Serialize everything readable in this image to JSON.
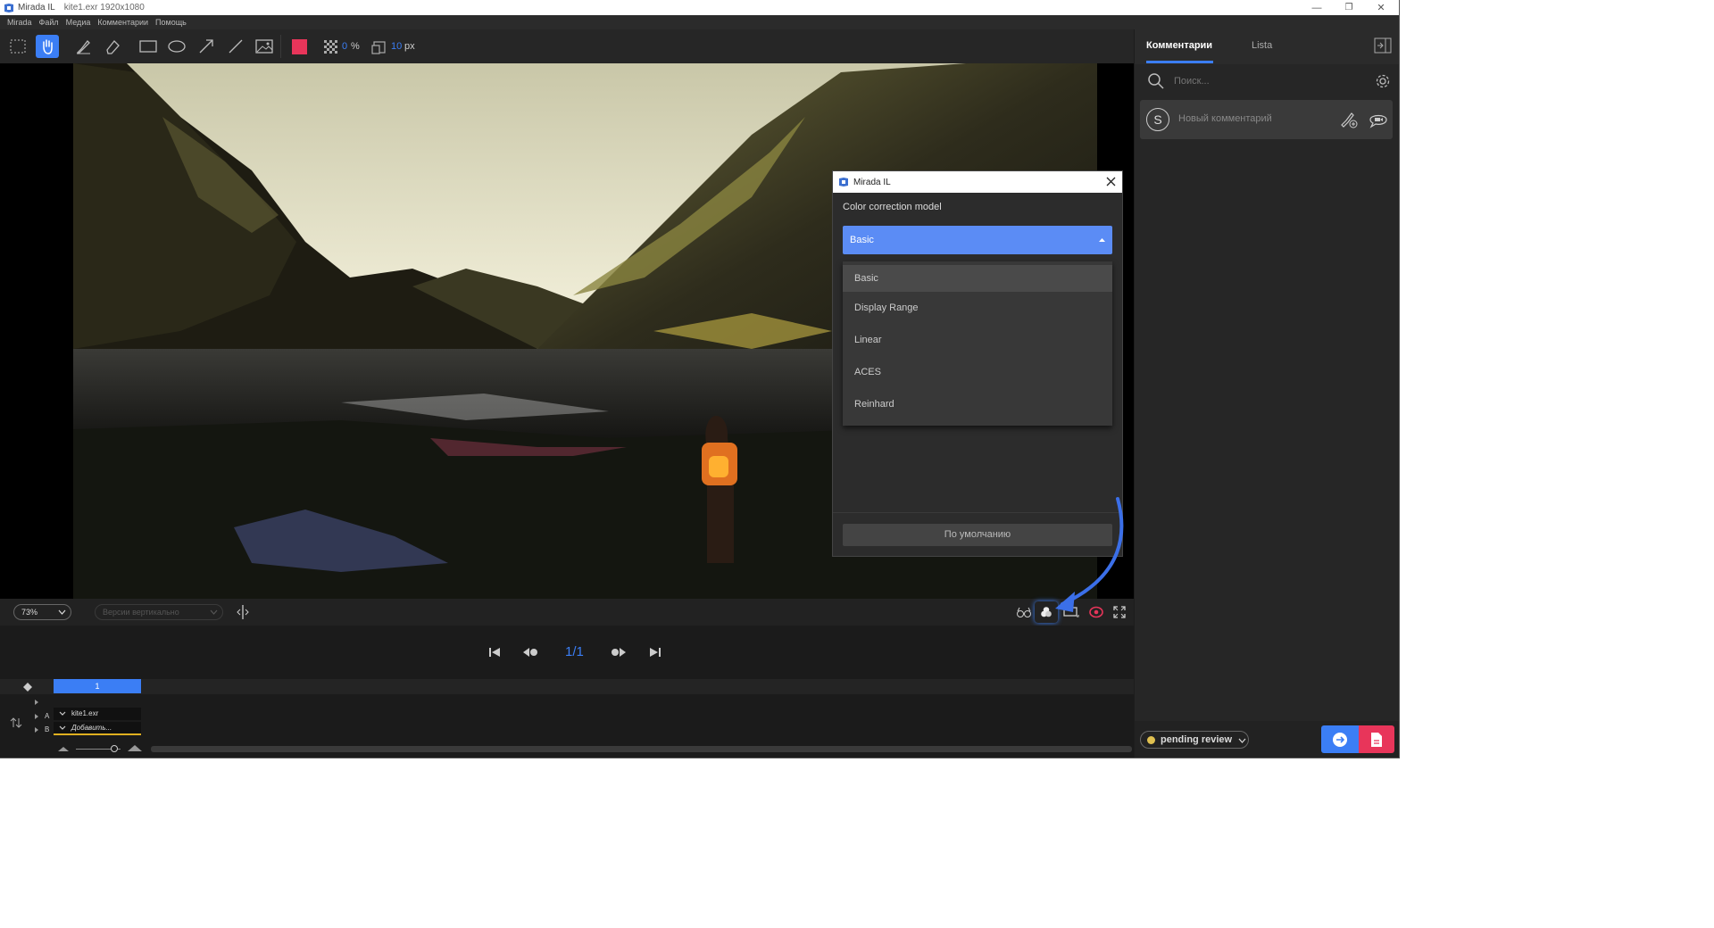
{
  "window": {
    "app_name": "Mirada IL",
    "file_title": "kite1.exr 1920x1080",
    "controls": {
      "minimize": "—",
      "restore": "❐",
      "close": "✕"
    }
  },
  "menu": [
    "Mirada",
    "Файл",
    "Медиа",
    "Комментарии",
    "Помощь"
  ],
  "toolbar": {
    "color": "#e8355a",
    "opacity_value": "0",
    "opacity_unit": "%",
    "stroke_value": "10",
    "stroke_unit": "px"
  },
  "viewer_bar": {
    "zoom": "73%",
    "version_mode": "Версии вертикально"
  },
  "player": {
    "frame_counter": "1/1"
  },
  "timeline": {
    "ruler_label": "1",
    "track_a_label": "A",
    "track_b_label": "B",
    "track_a_clip": "kite1.exr",
    "track_b_clip": "Добавить..."
  },
  "right_panel": {
    "tabs": [
      "Комментарии",
      "Lista"
    ],
    "active_tab": 0,
    "search_placeholder": "Поиск...",
    "avatar_letter": "S",
    "comment_placeholder": "Новый комментарий",
    "status": "pending review",
    "status_color": "#e0c050"
  },
  "dialog": {
    "title": "Mirada IL",
    "label": "Color correction model",
    "selected": "Basic",
    "options": [
      "Basic",
      "Display Range",
      "Linear",
      "ACES",
      "Reinhard"
    ],
    "reset_button": "По умолчанию"
  }
}
